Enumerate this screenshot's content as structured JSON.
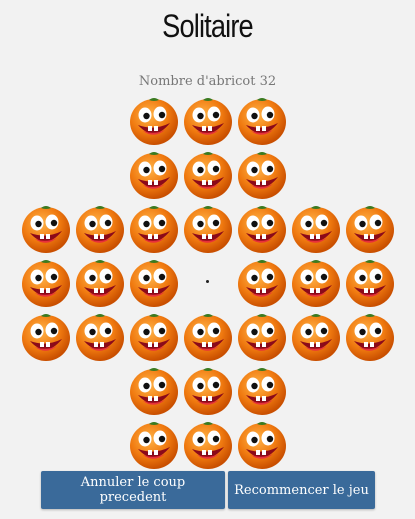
{
  "title": "Solitaire",
  "counter_text": "Nombre d'abricot 32",
  "board": {
    "rows": [
      [
        0,
        0,
        1,
        1,
        1,
        0,
        0
      ],
      [
        0,
        0,
        1,
        1,
        1,
        0,
        0
      ],
      [
        1,
        1,
        1,
        1,
        1,
        1,
        1
      ],
      [
        1,
        1,
        1,
        0,
        1,
        1,
        1
      ],
      [
        1,
        1,
        1,
        1,
        1,
        1,
        1
      ],
      [
        0,
        0,
        1,
        1,
        1,
        0,
        0
      ],
      [
        0,
        0,
        1,
        1,
        1,
        0,
        0
      ]
    ],
    "piece_icon": "apricot-face-icon",
    "empty_icon": "empty-hole-icon"
  },
  "buttons": {
    "undo_label": "Annuler le coup precedent",
    "restart_label": "Recommencer le jeu"
  },
  "colors": {
    "background": "#f2f2f2",
    "button": "#3a6a9a",
    "apricot": "#f07a10"
  }
}
